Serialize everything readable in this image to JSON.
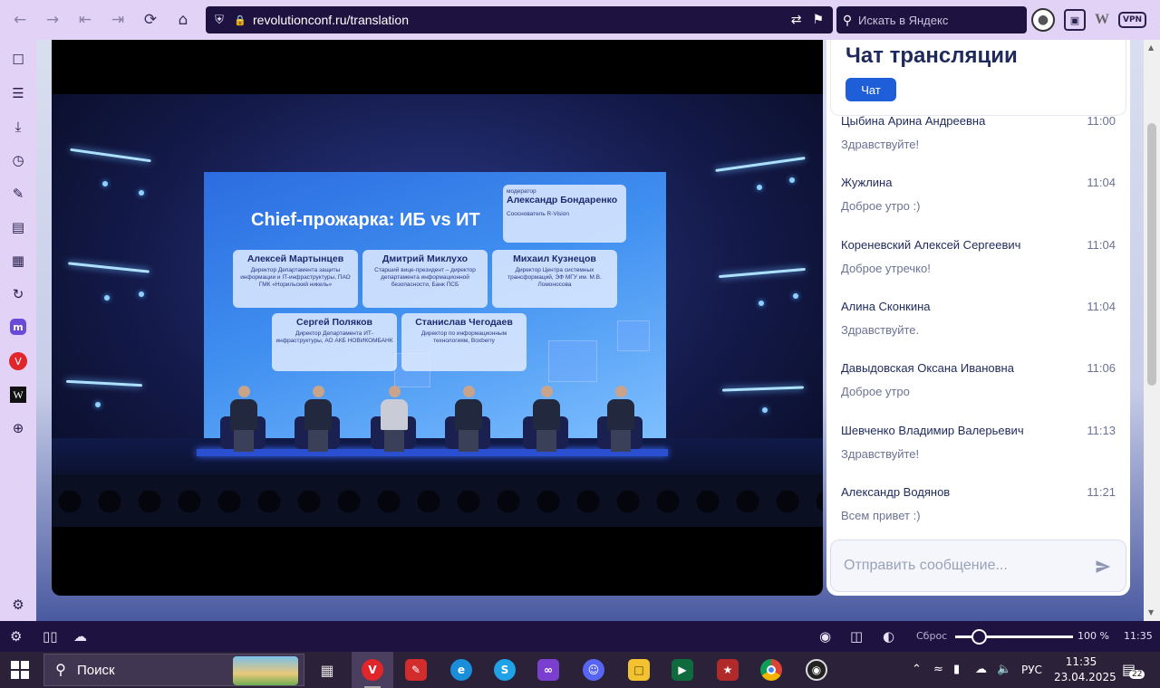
{
  "browser": {
    "url": "revolutionconf.ru/translation",
    "search_placeholder": "Искать в Яндекс",
    "vpn_label": "VPN"
  },
  "video": {
    "slide_title": "Chief-прожарка: ИБ vs ИТ",
    "moderator": {
      "label": "модератор",
      "name": "Александр Бондаренко",
      "role": "Сооснователь R-Vision"
    },
    "speakers": [
      {
        "name": "Алексей Мартынцев",
        "role": "Директор Департамента защиты информации и IT-инфраструктуры, ПАО ГМК «Норильский никель»"
      },
      {
        "name": "Дмитрий Миклухо",
        "role": "Старший вице-президент – директор департамента информационной безопасности, Банк ПСБ"
      },
      {
        "name": "Михаил Кузнецов",
        "role": "Директор Центра системных трансформаций, ЭФ МГУ им. М.В. Ломоносова"
      },
      {
        "name": "Сергей Поляков",
        "role": "Директор Департамента ИТ-инфраструктуры, АО АКБ НОВИКОМБАНК"
      },
      {
        "name": "Станислав Чегодаев",
        "role": "Директор по информационным технологиям, Boxberry"
      }
    ]
  },
  "chat": {
    "title": "Чат трансляции",
    "tab_label": "Чат",
    "input_placeholder": "Отправить сообщение...",
    "messages": [
      {
        "author": "Цыбина Арина Андреевна",
        "time": "11:00",
        "text": "Здравствуйте!"
      },
      {
        "author": "Жужлина",
        "time": "11:04",
        "text": "Доброе утро :)"
      },
      {
        "author": "Кореневский Алексей Сергеевич",
        "time": "11:04",
        "text": "Доброе утречко!"
      },
      {
        "author": "Алина Сконкина",
        "time": "11:04",
        "text": "Здравствуйте."
      },
      {
        "author": "Давыдовская Оксана Ивановна",
        "time": "11:06",
        "text": "Доброе утро"
      },
      {
        "author": "Шевченко Владимир Валерьевич",
        "time": "11:13",
        "text": "Здравствуйте!"
      },
      {
        "author": "Александр Водянов",
        "time": "11:21",
        "text": "Всем привет :)"
      }
    ]
  },
  "statusbar": {
    "reset_label": "Сброс",
    "zoom": "100 %",
    "time": "11:35"
  },
  "taskbar": {
    "search_label": "Поиск",
    "language": "РУС",
    "clock_time": "11:35",
    "clock_date": "23.04.2025",
    "notifications": "22"
  }
}
